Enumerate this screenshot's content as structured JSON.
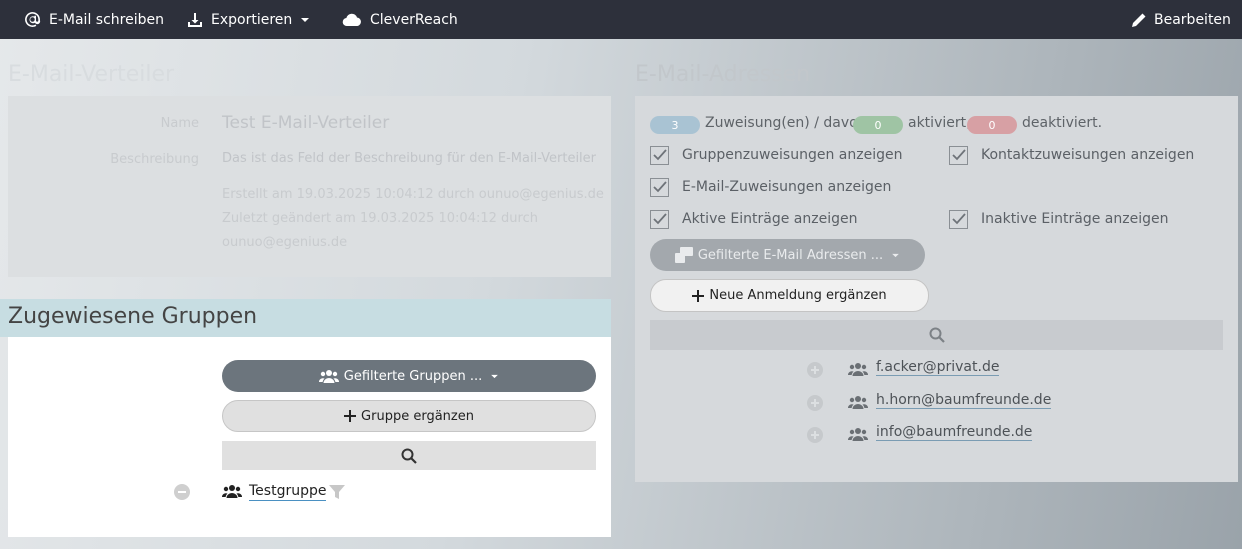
{
  "topbar": {
    "email_write": "E-Mail schreiben",
    "export": "Exportieren",
    "cleverreach": "CleverReach",
    "edit": "Bearbeiten"
  },
  "distribution": {
    "section_title": "E-Mail-Verteiler",
    "name_label": "Name",
    "name_value": "Test E-Mail-Verteiler",
    "description_label": "Beschreibung",
    "description_value": "Das ist das Feld der Beschreibung für den E-Mail-Verteiler",
    "created": "Erstellt am 19.03.2025 10:04:12 durch ounuo@egenius.de",
    "modified_line1": "Zuletzt geändert am 19.03.2025 10:04:12 durch",
    "modified_line2": "ounuo@egenius.de"
  },
  "groups": {
    "title": "Zugewiesene Gruppen",
    "filter_button": "Gefilterte Gruppen ...",
    "add_button": "Gruppe ergänzen",
    "items": [
      {
        "name": "Testgruppe"
      }
    ]
  },
  "addresses": {
    "section_title": "E-Mail-Adressen",
    "assignments_count": "3",
    "assignments_label": "Zuweisung(en) / davon",
    "active_count": "0",
    "active_label": "aktiviert,",
    "inactive_count": "0",
    "inactive_label": "deaktiviert.",
    "checkboxes": {
      "group_assignments": "Gruppenzuweisungen anzeigen",
      "contact_assignments": "Kontaktzuweisungen anzeigen",
      "email_assignments": "E-Mail-Zuweisungen anzeigen",
      "active_entries": "Aktive Einträge anzeigen",
      "inactive_entries": "Inaktive Einträge anzeigen"
    },
    "filter_button": "Gefilterte E-Mail Adressen ...",
    "new_button": "Neue Anmeldung ergänzen",
    "emails": [
      "f.acker@privat.de",
      "h.horn@baumfreunde.de",
      "info@baumfreunde.de"
    ]
  },
  "colors": {
    "topbar": "#2d303b",
    "pill_info": "#a9c3d3",
    "pill_success": "#9fc4a4",
    "pill_danger": "#d7a0a4"
  }
}
